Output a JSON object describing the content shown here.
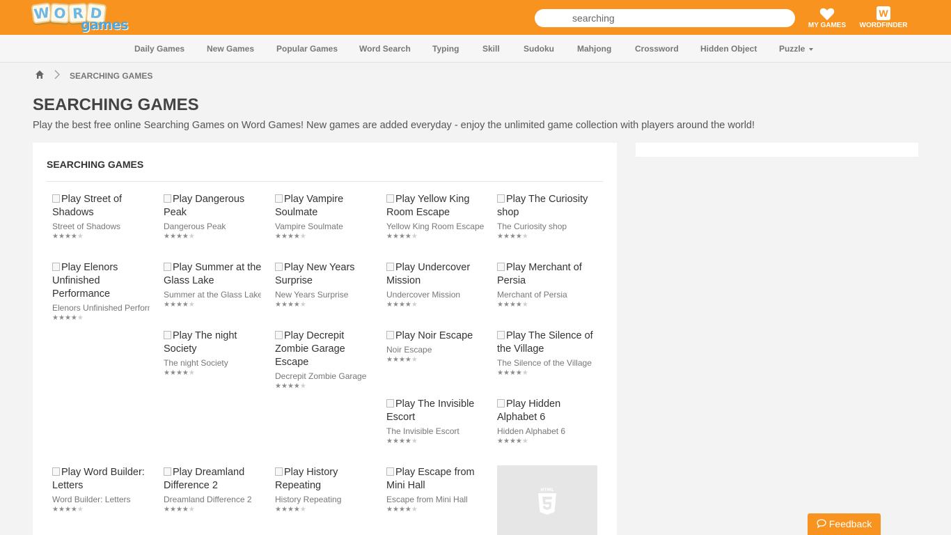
{
  "header": {
    "logo_word": "WORD",
    "logo_games": "games",
    "search_value": "searching",
    "my_games_label": "MY GAMES",
    "wordfinder_label": "WORDFINDER",
    "brand_color": "#f7931e"
  },
  "nav": {
    "items": [
      "Daily Games",
      "New Games",
      "Popular Games",
      "Word Search",
      "Typing",
      "Skill",
      "Sudoku",
      "Mahjong",
      "Crossword",
      "Hidden Object",
      "Puzzle"
    ]
  },
  "breadcrumb": {
    "home_icon": "home-icon",
    "current": "SEARCHING GAMES"
  },
  "page": {
    "title": "SEARCHING GAMES",
    "description": "Play the best free online Searching Games on Word Games! New games are added everyday - enjoy the unlimited game collection with players around the world!"
  },
  "panel": {
    "title": "SEARCHING GAMES"
  },
  "games": [
    {
      "alt": "Play Street of Shadows",
      "name": "Street of Shadows",
      "rating": 4
    },
    {
      "alt": "Play Dangerous Peak",
      "name": "Dangerous Peak",
      "rating": 4
    },
    {
      "alt": "Play Vampire Soulmate",
      "name": "Vampire Soulmate",
      "rating": 4
    },
    {
      "alt": "Play Yellow King Room Escape",
      "name": "Yellow King Room Escape",
      "rating": 4
    },
    {
      "alt": "Play The Curiosity shop",
      "name": "The Curiosity shop",
      "rating": 4
    },
    {
      "alt": "Play Elenors Unfinished Performance",
      "name": "Elenors Unfinished Performance",
      "rating": 4
    },
    {
      "alt": "Play Summer at the Glass Lake",
      "name": "Summer at the Glass Lake",
      "rating": 4
    },
    {
      "alt": "Play New Years Surprise",
      "name": "New Years Surprise",
      "rating": 4
    },
    {
      "alt": "Play Undercover Mission",
      "name": "Undercover Mission",
      "rating": 4
    },
    {
      "alt": "Play Merchant of Persia",
      "name": "Merchant of Persia",
      "rating": 4
    },
    {
      "alt": "Play The night Society",
      "name": "The night Society",
      "rating": 4
    },
    {
      "alt": "Play Decrepit Zombie Garage Escape",
      "name": "Decrepit Zombie Garage",
      "rating": 4
    },
    {
      "alt": "Play Noir Escape",
      "name": "Noir Escape",
      "rating": 4
    },
    {
      "alt": "Play The Silence of the Village",
      "name": "The Silence of the Village",
      "rating": 4
    },
    {
      "alt": "Play The Invisible Escort",
      "name": "The Invisible Escort",
      "rating": 4
    },
    {
      "alt": "Play Hidden Alphabet 6",
      "name": "Hidden Alphabet 6",
      "rating": 4
    },
    {
      "alt": "Play Word Builder: Letters",
      "name": "Word Builder: Letters",
      "rating": 4
    },
    {
      "alt": "Play Dreamland Difference 2",
      "name": "Dreamland Difference 2",
      "rating": 4
    },
    {
      "alt": "Play History Repeating",
      "name": "History Repeating",
      "rating": 4
    },
    {
      "alt": "Play Escape from Mini Hall",
      "name": "Escape from Mini Hall",
      "rating": 4
    }
  ],
  "placeholder_icon": "html5-icon",
  "feedback_label": "Feedback"
}
